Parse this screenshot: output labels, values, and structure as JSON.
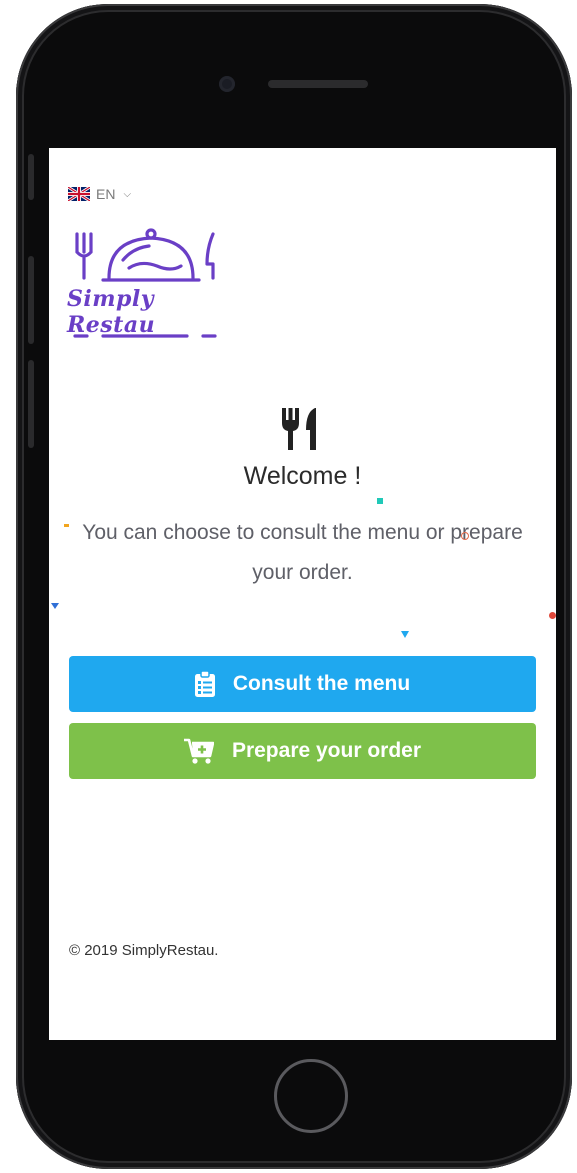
{
  "language": {
    "flag_icon": "uk-flag-icon",
    "code": "EN",
    "chevron_icon": "chevron-down-icon"
  },
  "brand": {
    "logo_text": "Simply Restau",
    "logo_color": "#6a3fc6"
  },
  "welcome": {
    "icon": "cutlery-icon",
    "title": "Welcome !",
    "intro": "You can choose to consult the menu or prepare your order."
  },
  "actions": {
    "consult": {
      "label": "Consult the menu",
      "icon": "clipboard-list-icon",
      "color": "#1fa8ef"
    },
    "prepare": {
      "label": "Prepare your order",
      "icon": "cart-plus-icon",
      "color": "#7ec14a"
    }
  },
  "footer": {
    "copyright": "© 2019 SimplyRestau."
  }
}
